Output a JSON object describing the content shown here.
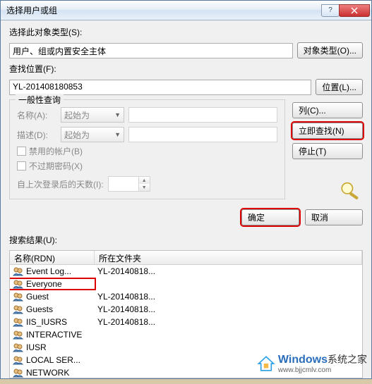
{
  "title": "选择用户或组",
  "object_type_label": "选择此对象类型(S):",
  "object_type_value": "用户、组或内置安全主体",
  "object_type_btn": "对象类型(O)...",
  "location_label": "查找位置(F):",
  "location_value": "YL-201408180853",
  "location_btn": "位置(L)...",
  "group_legend": "一般性查询",
  "name_label": "名称(A):",
  "desc_label": "描述(D):",
  "starts_with": "起始为",
  "chk_disabled": "禁用的帐户(B)",
  "chk_noexpire": "不过期密码(X)",
  "days_label": "自上次登录后的天数(I):",
  "btn_columns": "列(C)...",
  "btn_findnow": "立即查找(N)",
  "btn_stop": "停止(T)",
  "btn_ok": "确定",
  "btn_cancel": "取消",
  "results_label": "搜索结果(U):",
  "col_name": "名称(RDN)",
  "col_folder": "所在文件夹",
  "rows": [
    {
      "name": "Event Log...",
      "folder": "YL-20140818..."
    },
    {
      "name": "Everyone",
      "folder": ""
    },
    {
      "name": "Guest",
      "folder": "YL-20140818..."
    },
    {
      "name": "Guests",
      "folder": "YL-20140818..."
    },
    {
      "name": "IIS_IUSRS",
      "folder": "YL-20140818..."
    },
    {
      "name": "INTERACTIVE",
      "folder": ""
    },
    {
      "name": "IUSR",
      "folder": ""
    },
    {
      "name": "LOCAL SER...",
      "folder": ""
    },
    {
      "name": "NETWORK",
      "folder": ""
    }
  ],
  "watermark_main": "Windows",
  "watermark_sub": "系统之家",
  "watermark_url": "www.bjjcmlv.com"
}
